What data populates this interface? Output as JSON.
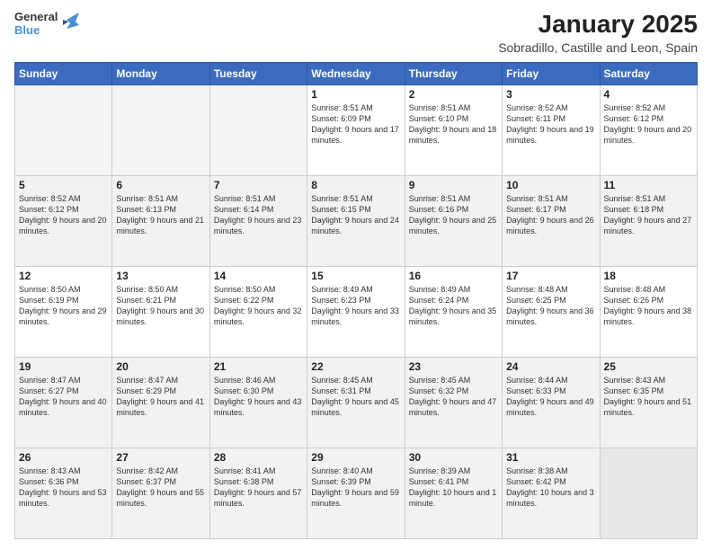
{
  "header": {
    "logo_general": "General",
    "logo_blue": "Blue",
    "month_year": "January 2025",
    "location": "Sobradillo, Castille and Leon, Spain"
  },
  "weekdays": [
    "Sunday",
    "Monday",
    "Tuesday",
    "Wednesday",
    "Thursday",
    "Friday",
    "Saturday"
  ],
  "weeks": [
    [
      {
        "day": "",
        "detail": ""
      },
      {
        "day": "",
        "detail": ""
      },
      {
        "day": "",
        "detail": ""
      },
      {
        "day": "1",
        "detail": "Sunrise: 8:51 AM\nSunset: 6:09 PM\nDaylight: 9 hours\nand 17 minutes."
      },
      {
        "day": "2",
        "detail": "Sunrise: 8:51 AM\nSunset: 6:10 PM\nDaylight: 9 hours\nand 18 minutes."
      },
      {
        "day": "3",
        "detail": "Sunrise: 8:52 AM\nSunset: 6:11 PM\nDaylight: 9 hours\nand 19 minutes."
      },
      {
        "day": "4",
        "detail": "Sunrise: 8:52 AM\nSunset: 6:12 PM\nDaylight: 9 hours\nand 20 minutes."
      }
    ],
    [
      {
        "day": "5",
        "detail": "Sunrise: 8:52 AM\nSunset: 6:12 PM\nDaylight: 9 hours\nand 20 minutes."
      },
      {
        "day": "6",
        "detail": "Sunrise: 8:51 AM\nSunset: 6:13 PM\nDaylight: 9 hours\nand 21 minutes."
      },
      {
        "day": "7",
        "detail": "Sunrise: 8:51 AM\nSunset: 6:14 PM\nDaylight: 9 hours\nand 23 minutes."
      },
      {
        "day": "8",
        "detail": "Sunrise: 8:51 AM\nSunset: 6:15 PM\nDaylight: 9 hours\nand 24 minutes."
      },
      {
        "day": "9",
        "detail": "Sunrise: 8:51 AM\nSunset: 6:16 PM\nDaylight: 9 hours\nand 25 minutes."
      },
      {
        "day": "10",
        "detail": "Sunrise: 8:51 AM\nSunset: 6:17 PM\nDaylight: 9 hours\nand 26 minutes."
      },
      {
        "day": "11",
        "detail": "Sunrise: 8:51 AM\nSunset: 6:18 PM\nDaylight: 9 hours\nand 27 minutes."
      }
    ],
    [
      {
        "day": "12",
        "detail": "Sunrise: 8:50 AM\nSunset: 6:19 PM\nDaylight: 9 hours\nand 29 minutes."
      },
      {
        "day": "13",
        "detail": "Sunrise: 8:50 AM\nSunset: 6:21 PM\nDaylight: 9 hours\nand 30 minutes."
      },
      {
        "day": "14",
        "detail": "Sunrise: 8:50 AM\nSunset: 6:22 PM\nDaylight: 9 hours\nand 32 minutes."
      },
      {
        "day": "15",
        "detail": "Sunrise: 8:49 AM\nSunset: 6:23 PM\nDaylight: 9 hours\nand 33 minutes."
      },
      {
        "day": "16",
        "detail": "Sunrise: 8:49 AM\nSunset: 6:24 PM\nDaylight: 9 hours\nand 35 minutes."
      },
      {
        "day": "17",
        "detail": "Sunrise: 8:48 AM\nSunset: 6:25 PM\nDaylight: 9 hours\nand 36 minutes."
      },
      {
        "day": "18",
        "detail": "Sunrise: 8:48 AM\nSunset: 6:26 PM\nDaylight: 9 hours\nand 38 minutes."
      }
    ],
    [
      {
        "day": "19",
        "detail": "Sunrise: 8:47 AM\nSunset: 6:27 PM\nDaylight: 9 hours\nand 40 minutes."
      },
      {
        "day": "20",
        "detail": "Sunrise: 8:47 AM\nSunset: 6:29 PM\nDaylight: 9 hours\nand 41 minutes."
      },
      {
        "day": "21",
        "detail": "Sunrise: 8:46 AM\nSunset: 6:30 PM\nDaylight: 9 hours\nand 43 minutes."
      },
      {
        "day": "22",
        "detail": "Sunrise: 8:45 AM\nSunset: 6:31 PM\nDaylight: 9 hours\nand 45 minutes."
      },
      {
        "day": "23",
        "detail": "Sunrise: 8:45 AM\nSunset: 6:32 PM\nDaylight: 9 hours\nand 47 minutes."
      },
      {
        "day": "24",
        "detail": "Sunrise: 8:44 AM\nSunset: 6:33 PM\nDaylight: 9 hours\nand 49 minutes."
      },
      {
        "day": "25",
        "detail": "Sunrise: 8:43 AM\nSunset: 6:35 PM\nDaylight: 9 hours\nand 51 minutes."
      }
    ],
    [
      {
        "day": "26",
        "detail": "Sunrise: 8:43 AM\nSunset: 6:36 PM\nDaylight: 9 hours\nand 53 minutes."
      },
      {
        "day": "27",
        "detail": "Sunrise: 8:42 AM\nSunset: 6:37 PM\nDaylight: 9 hours\nand 55 minutes."
      },
      {
        "day": "28",
        "detail": "Sunrise: 8:41 AM\nSunset: 6:38 PM\nDaylight: 9 hours\nand 57 minutes."
      },
      {
        "day": "29",
        "detail": "Sunrise: 8:40 AM\nSunset: 6:39 PM\nDaylight: 9 hours\nand 59 minutes."
      },
      {
        "day": "30",
        "detail": "Sunrise: 8:39 AM\nSunset: 6:41 PM\nDaylight: 10 hours\nand 1 minute."
      },
      {
        "day": "31",
        "detail": "Sunrise: 8:38 AM\nSunset: 6:42 PM\nDaylight: 10 hours\nand 3 minutes."
      },
      {
        "day": "",
        "detail": ""
      }
    ]
  ]
}
